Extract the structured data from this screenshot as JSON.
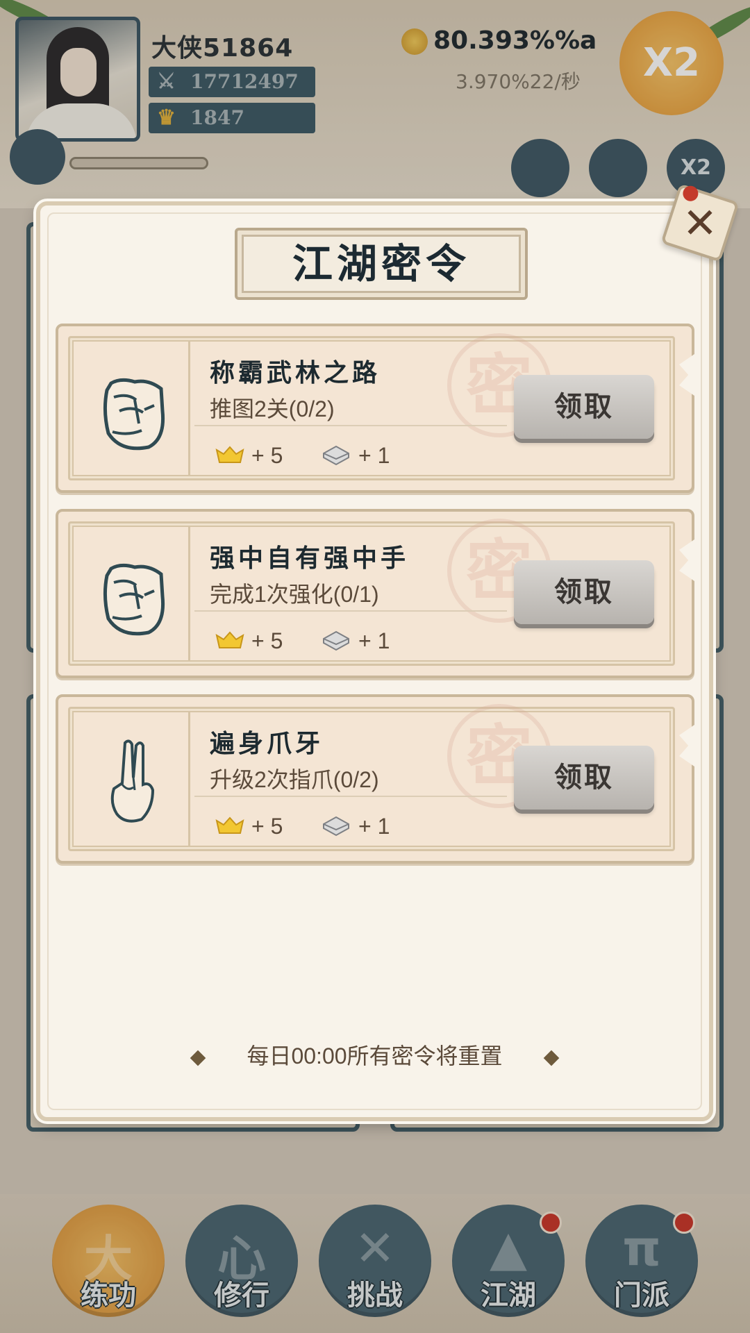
{
  "player": {
    "name": "大侠51864",
    "power": "17712497",
    "ingots": "1847",
    "gold": "80.393%%a",
    "gold_rate": "3.970%22/秒",
    "double_label": "X2"
  },
  "top_icons": [
    {
      "name": "scroll",
      "label": ""
    },
    {
      "name": "pill",
      "label": ""
    },
    {
      "name": "x2",
      "label": "X2"
    }
  ],
  "modal": {
    "title": "江湖密令",
    "close_icon": "close-x-icon",
    "footer": "每日00:00所有密令将重置",
    "tasks": [
      {
        "name": "称霸武林之路",
        "desc": "推图2关(0/2)",
        "icon": "fist-icon",
        "reward_ingot": "+ 5",
        "reward_silver": "+ 1",
        "button": "领取"
      },
      {
        "name": "强中自有强中手",
        "desc": "完成1次强化(0/1)",
        "icon": "fist-icon",
        "reward_ingot": "+ 5",
        "reward_silver": "+ 1",
        "button": "领取"
      },
      {
        "name": "遍身爪牙",
        "desc": "升级2次指爪(0/2)",
        "icon": "two-finger-hand-icon",
        "reward_ingot": "+ 5",
        "reward_silver": "+ 1",
        "button": "领取"
      }
    ]
  },
  "nav": [
    {
      "label": "练功",
      "active": true,
      "badge": false
    },
    {
      "label": "修行",
      "active": false,
      "badge": false
    },
    {
      "label": "挑战",
      "active": false,
      "badge": false
    },
    {
      "label": "江湖",
      "active": false,
      "badge": true
    },
    {
      "label": "门派",
      "active": false,
      "badge": true
    }
  ],
  "colors": {
    "modal_bg": "#f8f3ea",
    "card_bg": "#f4e5d4",
    "nav_blue": "#4a6672",
    "accent_orange": "#e59a37",
    "badge_red": "#c9362a"
  }
}
